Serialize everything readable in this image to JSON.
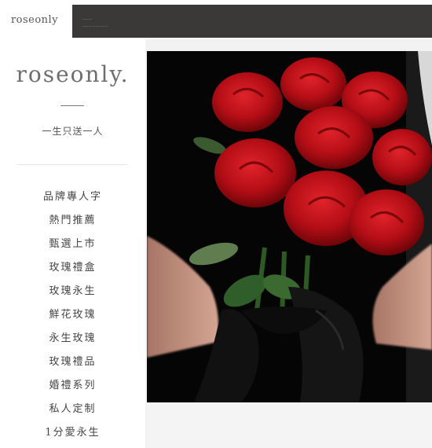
{
  "header": {
    "logo_text": "roseonly",
    "dark_banner_lines": [
      "......",
      "..............."
    ]
  },
  "sidebar": {
    "brand": "roseonly.",
    "tagline": "一生只送一人",
    "menu": [
      {
        "label": "品牌專人字"
      },
      {
        "label": "熱門推薦"
      },
      {
        "label": "甄選上市"
      },
      {
        "label": "玫瑰禮盒"
      },
      {
        "label": "玫瑰永生"
      },
      {
        "label": "鮮花玫瑰"
      },
      {
        "label": "永生玫瑰"
      },
      {
        "label": "玫瑰禮品"
      },
      {
        "label": "婚禮系列"
      },
      {
        "label": "私人定制"
      },
      {
        "label": "1分愛永生"
      }
    ]
  },
  "hero": {
    "image_subject": "red-rose-bouquet",
    "colors": {
      "background": "#050505",
      "rose": "#c8101a",
      "ribbon": "#111111",
      "skin": "#c99a88"
    }
  }
}
